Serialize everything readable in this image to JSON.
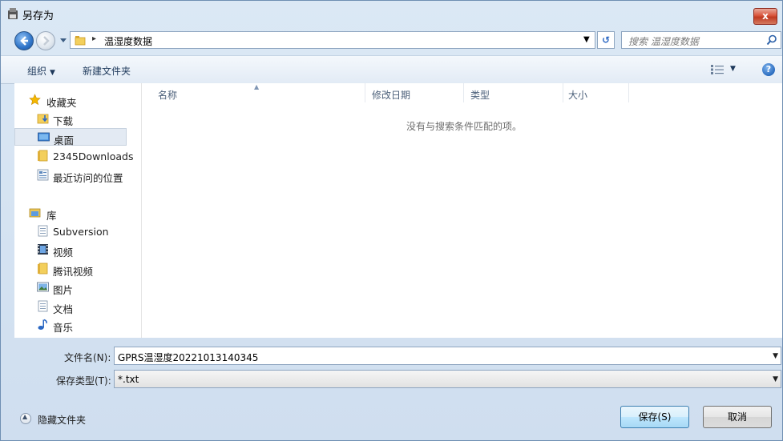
{
  "window": {
    "title": "另存为",
    "close_label": "x"
  },
  "nav": {
    "address_path": "温湿度数据",
    "address_separator": "▸",
    "search_placeholder": "搜索 温湿度数据"
  },
  "toolbar": {
    "organize_label": "组织",
    "new_folder_label": "新建文件夹"
  },
  "sidebar": {
    "items": [
      {
        "label": "收藏夹",
        "icon": "star-icon"
      },
      {
        "label": "下载",
        "icon": "download-folder-icon"
      },
      {
        "label": "桌面",
        "icon": "desktop-icon"
      },
      {
        "label": "2345Downloads",
        "icon": "folder-icon"
      },
      {
        "label": "最近访问的位置",
        "icon": "recent-places-icon"
      },
      {
        "label": "库",
        "icon": "library-icon"
      },
      {
        "label": "Subversion",
        "icon": "document-icon"
      },
      {
        "label": "视频",
        "icon": "video-icon"
      },
      {
        "label": "腾讯视频",
        "icon": "folder-icon"
      },
      {
        "label": "图片",
        "icon": "picture-icon"
      },
      {
        "label": "文档",
        "icon": "document-icon"
      },
      {
        "label": "音乐",
        "icon": "music-icon"
      }
    ]
  },
  "filelist": {
    "columns": [
      "名称",
      "修改日期",
      "类型",
      "大小"
    ],
    "empty_message": "没有与搜索条件匹配的项。"
  },
  "form": {
    "filename_label": "文件名(N):",
    "filename_value": "GPRS温湿度20221013140345",
    "filetype_label": "保存类型(T):",
    "filetype_value": "*.txt"
  },
  "footer": {
    "hide_folders_label": "隐藏文件夹",
    "save_label": "保存(S)",
    "cancel_label": "取消"
  },
  "colors": {
    "accent": "#2f74c8",
    "close_red": "#c03a22",
    "dialog_bg": "#dbe8f5"
  }
}
